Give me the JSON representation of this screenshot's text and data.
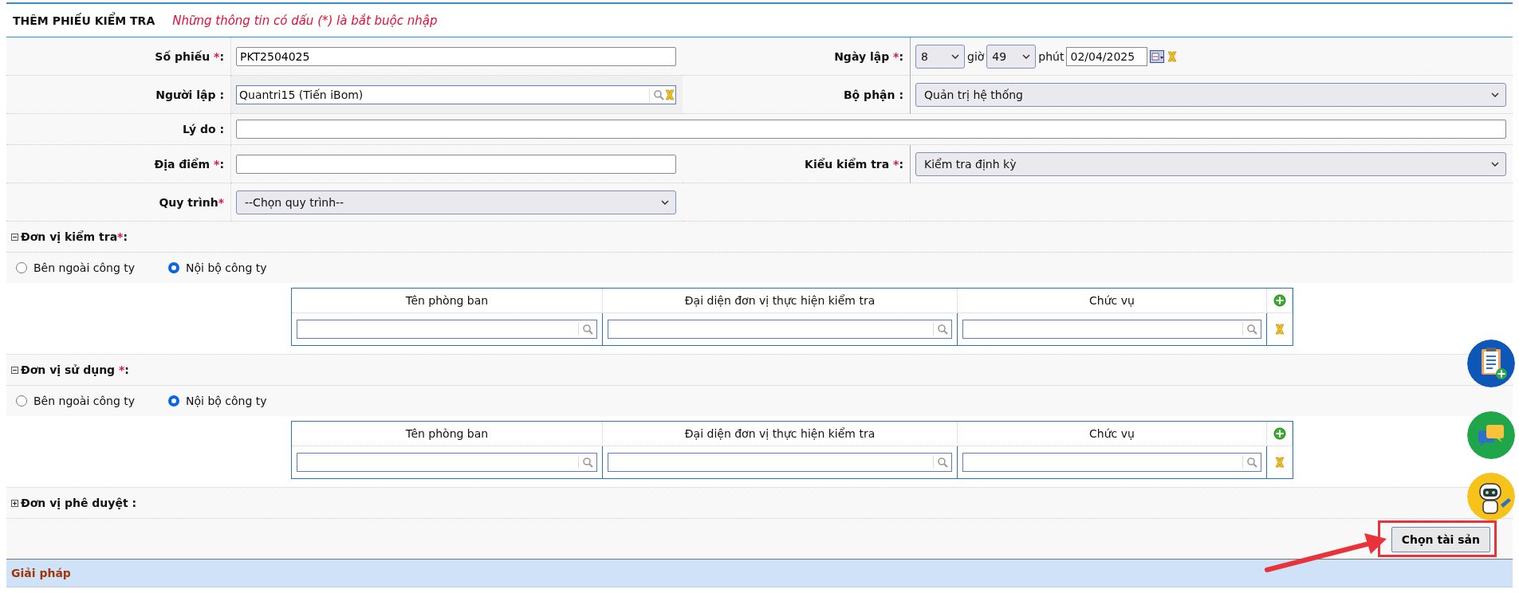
{
  "header": {
    "title": "THÊM PHIẾU KIỂM TRA",
    "note": "Những thông tin có dấu (*) là bắt buộc nhập"
  },
  "form_rows": [
    {
      "left": {
        "kind": "text",
        "label": "Số phiếu ",
        "mark": "*",
        "end": ":",
        "value": "PKT2504025"
      },
      "right": {
        "kind": "datetime",
        "label": "Ngày lập ",
        "mark": "*",
        "end": ":",
        "hour": "8",
        "hour_unit": "giờ",
        "minute": "49",
        "minute_unit": "phút",
        "date": "02/04/2025"
      }
    },
    {
      "left": {
        "kind": "lookup",
        "label": "Người lập :",
        "value": "Quantri15 (Tiến iBom)"
      },
      "right": {
        "kind": "select",
        "label": "Bộ phận :",
        "value": "Quản trị hệ thống"
      }
    },
    {
      "left": {
        "kind": "wide",
        "label": "Lý do :"
      }
    },
    {
      "left": {
        "kind": "text",
        "label": "Địa điểm ",
        "mark": "*",
        "end": ":"
      },
      "right": {
        "kind": "select",
        "label": "Kiểu kiểm tra ",
        "mark": "*",
        "end": ":",
        "value": "Kiểm tra định kỳ"
      }
    },
    {
      "left": {
        "kind": "select",
        "label": "Quy trình",
        "mark": "*",
        "value": "--Chọn quy trình--"
      }
    }
  ],
  "sections": [
    {
      "title": "Đơn vị kiểm tra",
      "mark": "*",
      "end": ":",
      "expanded": true,
      "options": [
        {
          "label": "Bên ngoài công ty",
          "selected": false
        },
        {
          "label": "Nội bộ công ty",
          "selected": true
        }
      ],
      "columns": [
        "Tên phòng ban",
        "Đại diện đơn vị thực hiện kiểm tra",
        "Chức vụ"
      ]
    },
    {
      "title": "Đơn vị sử dụng ",
      "mark": "*",
      "end": ":",
      "expanded": true,
      "options": [
        {
          "label": "Bên ngoài công ty",
          "selected": false
        },
        {
          "label": "Nội bộ công ty",
          "selected": true
        }
      ],
      "columns": [
        "Tên phòng ban",
        "Đại diện đơn vị thực hiện kiểm tra",
        "Chức vụ"
      ]
    },
    {
      "title": "Đơn vị phê duyệt :",
      "expanded": false
    }
  ],
  "choose_asset_button": {
    "label": "Chọn tài sản",
    "highlighted": true
  },
  "solution_panel": {
    "title": "Giải pháp"
  }
}
